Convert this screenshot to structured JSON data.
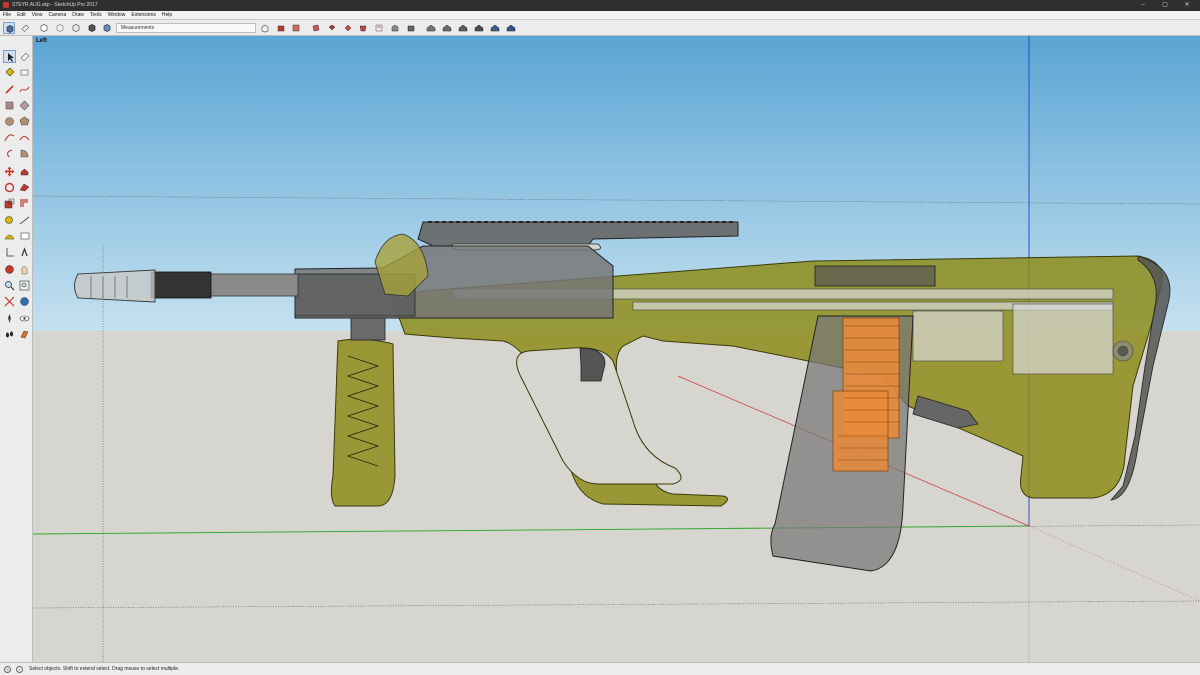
{
  "window": {
    "title": "STEYR AUG.skp - SketchUp Pro 2017",
    "controls": {
      "minimize": "–",
      "maximize": "▢",
      "close": "✕"
    }
  },
  "menu": [
    "File",
    "Edit",
    "View",
    "Camera",
    "Draw",
    "Tools",
    "Window",
    "Extensions",
    "Help"
  ],
  "toolbar": {
    "measurements_label": "Measurements"
  },
  "viewport": {
    "scene_label": "Left"
  },
  "status": {
    "message": "Select objects. Shift to extend select. Drag mouse to select multiple."
  },
  "colors": {
    "sky_top": "#5aa5d4",
    "sky_bottom": "#c5e1f0",
    "ground": "#d6d5cf",
    "stock": "#8c8a14",
    "metal": "#8a8a8a",
    "rounds": "#e98a3a",
    "axis_red": "#d03030",
    "axis_green": "#2eaa2e",
    "axis_blue": "#2a3fc0"
  }
}
